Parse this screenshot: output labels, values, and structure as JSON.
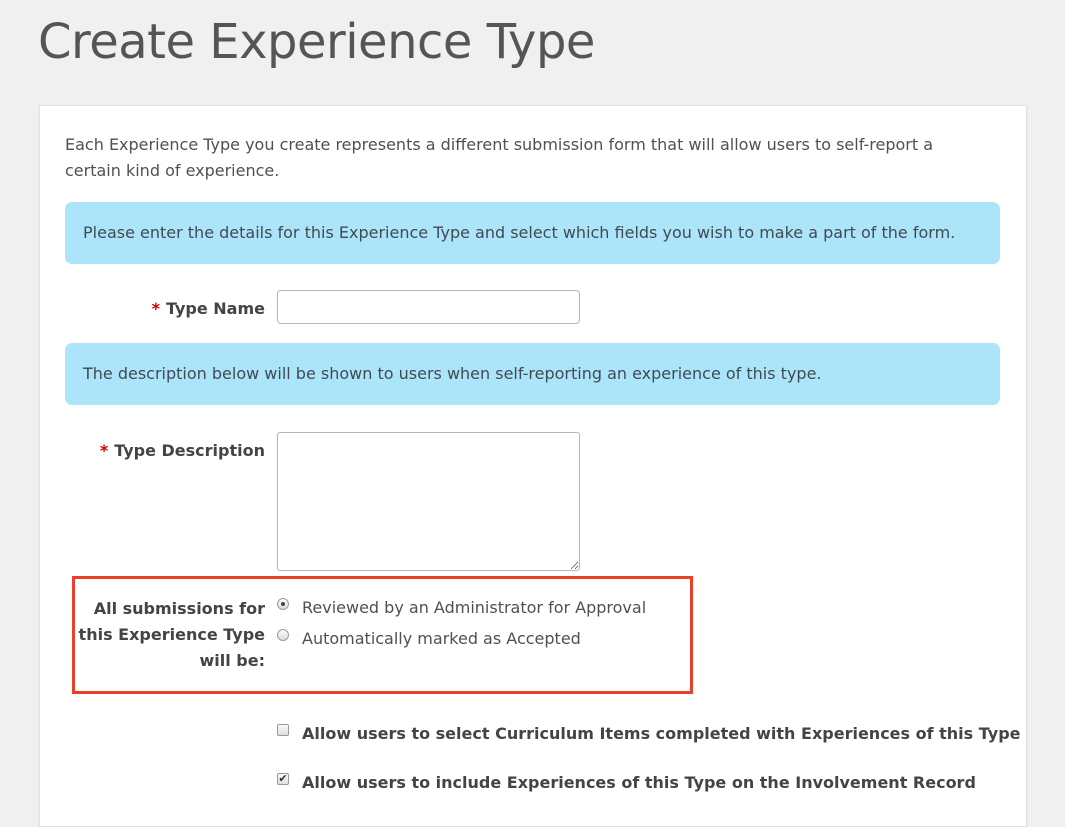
{
  "page": {
    "title": "Create Experience Type"
  },
  "form": {
    "intro_line1": "Each Experience Type you create represents a different submission form that will allow users to self-report a",
    "intro_line2": "certain kind of experience.",
    "info_details": "Please enter the details for this Experience Type and select which fields you wish to make a part of the form.",
    "info_description": "The description below will be shown to users when self-reporting an experience of this type.",
    "type_name": {
      "required_mark": "*",
      "label": "Type Name",
      "value": ""
    },
    "type_description": {
      "required_mark": "*",
      "label": "Type Description",
      "value": ""
    },
    "submissions": {
      "label_line1": "All submissions for",
      "label_line2": "this Experience Type",
      "label_line3": "will be:",
      "options": [
        {
          "label": "Reviewed by an Administrator for Approval",
          "selected": true
        },
        {
          "label": "Automatically marked as Accepted",
          "selected": false
        }
      ]
    },
    "checkboxes": [
      {
        "label": "Allow users to select Curriculum Items completed with Experiences of this Type",
        "checked": false,
        "mark": ""
      },
      {
        "label": "Allow users to include Experiences of this Type on the Involvement Record",
        "checked": true,
        "mark": "✔"
      }
    ]
  },
  "colors": {
    "info_background": "#ace5fa",
    "highlight_border": "#e8402a",
    "required": "#cc0000"
  }
}
